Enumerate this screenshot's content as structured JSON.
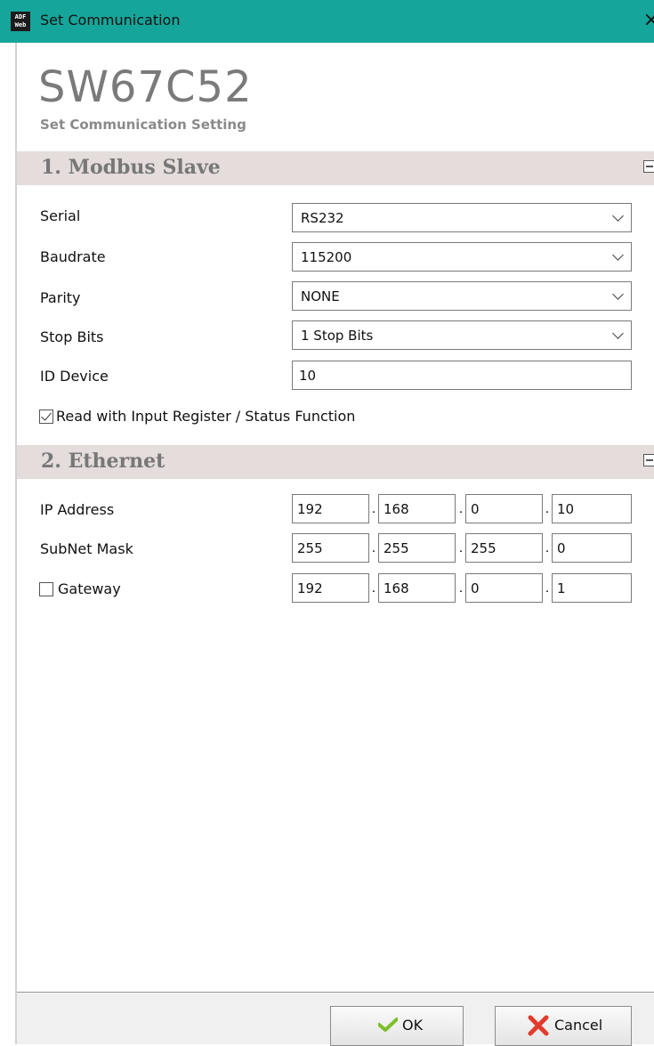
{
  "window": {
    "title": "Set Communication",
    "app_icon_text": [
      "ADF",
      "Web"
    ],
    "close_glyph": "×"
  },
  "header": {
    "product": "SW67C52",
    "subtitle": "Set Communication Setting"
  },
  "modbus": {
    "title": "1. Modbus Slave",
    "serial": {
      "label": "Serial",
      "value": "RS232"
    },
    "baudrate": {
      "label": "Baudrate",
      "value": "115200"
    },
    "parity": {
      "label": "Parity",
      "value": "NONE"
    },
    "stop_bits": {
      "label": "Stop Bits",
      "value": "1 Stop Bits"
    },
    "id_device": {
      "label": "ID Device",
      "value": "10"
    },
    "read_input": {
      "label": "Read with Input Register / Status Function",
      "checked": true
    }
  },
  "ethernet": {
    "title": "2. Ethernet",
    "ip": {
      "label": "IP Address",
      "octets": [
        "192",
        "168",
        "0",
        "10"
      ]
    },
    "subnet": {
      "label": "SubNet Mask",
      "octets": [
        "255",
        "255",
        "255",
        "0"
      ]
    },
    "gateway": {
      "label": "Gateway",
      "checked": false,
      "octets": [
        "192",
        "168",
        "0",
        "1"
      ]
    },
    "separator": "."
  },
  "buttons": {
    "ok": "OK",
    "cancel": "Cancel"
  },
  "colors": {
    "titlebar": "#16a59a",
    "section_header": "#e5dcdc",
    "ok_icon": "#7cbf2a",
    "cancel_icon": "#e23b2e"
  }
}
